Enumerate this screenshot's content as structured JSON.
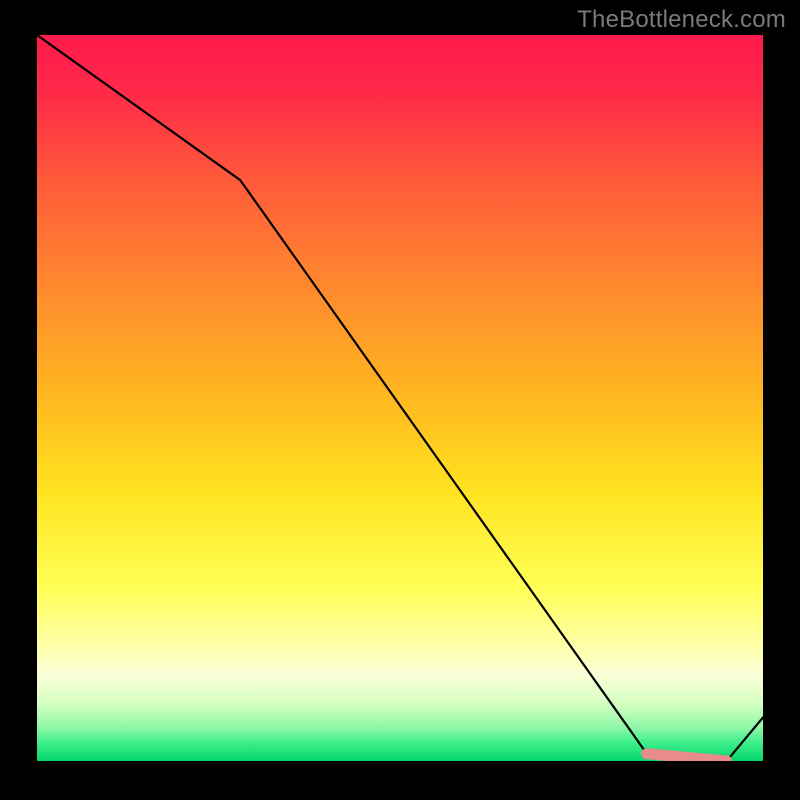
{
  "watermark": "TheBottleneck.com",
  "chart_data": {
    "type": "line",
    "title": "",
    "xlabel": "",
    "ylabel": "",
    "xlim": [
      0,
      100
    ],
    "ylim": [
      0,
      100
    ],
    "x": [
      0,
      28,
      84,
      95,
      100
    ],
    "values": [
      100,
      80,
      1,
      0,
      6
    ],
    "highlight_segment": {
      "x_start": 84,
      "x_end": 95
    },
    "background_gradient": {
      "top": "#ff1744",
      "mid": "#ffeb3b",
      "bottom_band": "#00e676"
    }
  }
}
